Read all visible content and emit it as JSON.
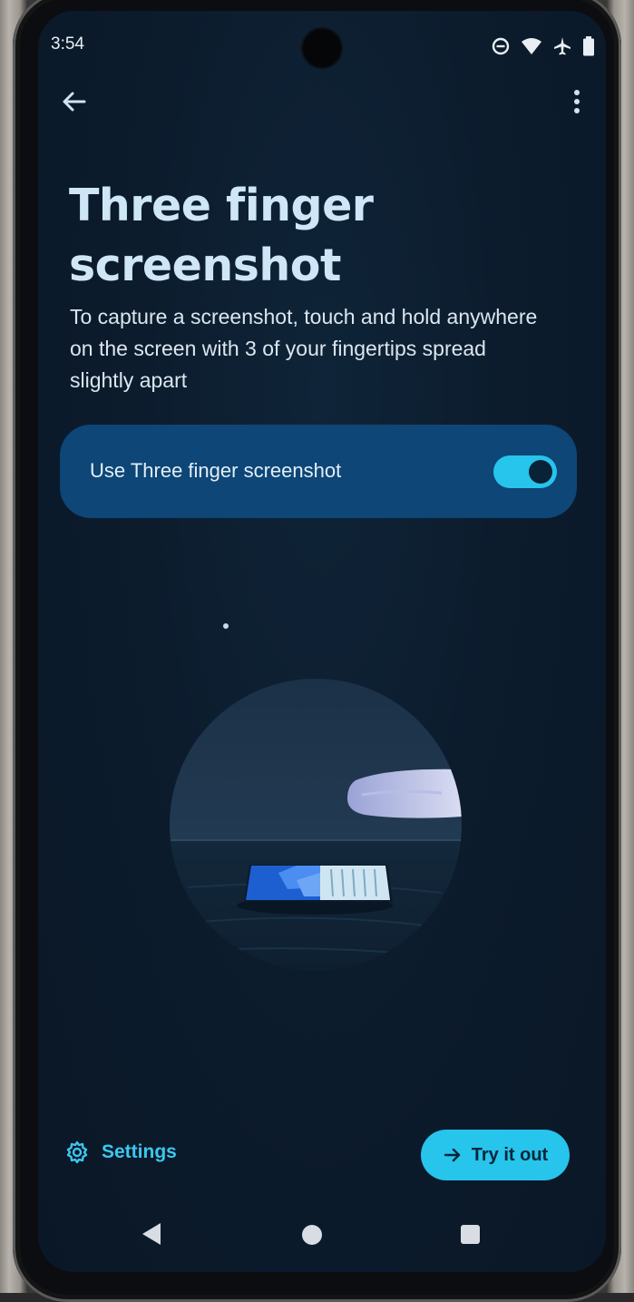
{
  "status_bar": {
    "time": "3:54",
    "icons": [
      "do-not-disturb-icon",
      "wifi-icon",
      "airplane-icon",
      "battery-icon"
    ]
  },
  "app_bar": {
    "back_icon": "arrow-left-icon",
    "menu_icon": "more-vert-icon"
  },
  "page": {
    "title_line1": "Three finger",
    "title_line2": "screenshot",
    "description_line1": "To capture a screenshot, touch and hold anywhere",
    "description_line2": "on the screen with 3 of your fingertips spread",
    "description_line3": "slightly apart"
  },
  "toggle": {
    "label": "Use Three finger screenshot",
    "checked": true
  },
  "footer": {
    "settings_label": "Settings",
    "try_label": "Try it out"
  },
  "nav": {
    "back_icon": "nav-back-icon",
    "home_icon": "nav-home-icon",
    "recents_icon": "nav-recents-icon"
  },
  "colors": {
    "accent": "#27c4ec",
    "card": "#0d4677",
    "background": "#0c1c2d",
    "title": "#cfe6f7"
  }
}
